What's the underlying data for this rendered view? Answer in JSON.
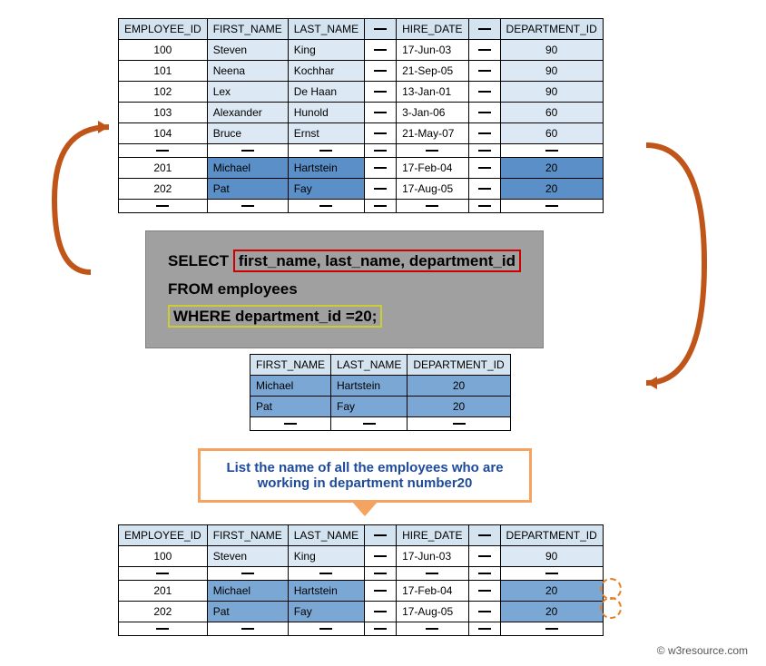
{
  "table1": {
    "headers": [
      "EMPLOYEE_ID",
      "FIRST_NAME",
      "LAST_NAME",
      "—",
      "HIRE_DATE",
      "—",
      "DEPARTMENT_ID"
    ],
    "rows": [
      {
        "emp_id": "100",
        "first": "Steven",
        "last": "King",
        "hire": "17-Jun-03",
        "dept": "90",
        "highlight": "light"
      },
      {
        "emp_id": "101",
        "first": "Neena",
        "last": "Kochhar",
        "hire": "21-Sep-05",
        "dept": "90",
        "highlight": "light"
      },
      {
        "emp_id": "102",
        "first": "Lex",
        "last": "De Haan",
        "hire": "13-Jan-01",
        "dept": "90",
        "highlight": "light"
      },
      {
        "emp_id": "103",
        "first": "Alexander",
        "last": "Hunold",
        "hire": "3-Jan-06",
        "dept": "60",
        "highlight": "light"
      },
      {
        "emp_id": "104",
        "first": "Bruce",
        "last": "Ernst",
        "hire": "21-May-07",
        "dept": "60",
        "highlight": "light"
      },
      {
        "emp_id": "",
        "first": "",
        "last": "",
        "hire": "",
        "dept": "",
        "highlight": "dashrow"
      },
      {
        "emp_id": "201",
        "first": "Michael",
        "last": "Hartstein",
        "hire": "17-Feb-04",
        "dept": "20",
        "highlight": "dark"
      },
      {
        "emp_id": "202",
        "first": "Pat",
        "last": "Fay",
        "hire": "17-Aug-05",
        "dept": "20",
        "highlight": "dark"
      },
      {
        "emp_id": "",
        "first": "",
        "last": "",
        "hire": "",
        "dept": "",
        "highlight": "dashrow"
      }
    ]
  },
  "sql": {
    "select_kw": "SELECT",
    "columns": "first_name, last_name, department_id",
    "from_kw": "FROM",
    "table": "employees",
    "where_kw": "WHERE",
    "where_cond": "department_id =20;"
  },
  "table2": {
    "headers": [
      "FIRST_NAME",
      "LAST_NAME",
      "DEPARTMENT_ID"
    ],
    "rows": [
      {
        "first": "Michael",
        "last": "Hartstein",
        "dept": "20"
      },
      {
        "first": "Pat",
        "last": "Fay",
        "dept": "20"
      }
    ]
  },
  "callout": "List the name of all the employees who are working in department number20",
  "table3": {
    "headers": [
      "EMPLOYEE_ID",
      "FIRST_NAME",
      "LAST_NAME",
      "—",
      "HIRE_DATE",
      "—",
      "DEPARTMENT_ID"
    ],
    "rows": [
      {
        "emp_id": "100",
        "first": "Steven",
        "last": "King",
        "hire": "17-Jun-03",
        "dept": "90",
        "highlight": "light"
      },
      {
        "emp_id": "",
        "first": "",
        "last": "",
        "hire": "",
        "dept": "",
        "highlight": "dashrow"
      },
      {
        "emp_id": "201",
        "first": "Michael",
        "last": "Hartstein",
        "hire": "17-Feb-04",
        "dept": "20",
        "highlight": "med"
      },
      {
        "emp_id": "202",
        "first": "Pat",
        "last": "Fay",
        "hire": "17-Aug-05",
        "dept": "20",
        "highlight": "med"
      },
      {
        "emp_id": "",
        "first": "",
        "last": "",
        "hire": "",
        "dept": "",
        "highlight": "dashrow"
      }
    ]
  },
  "copyright": "© w3resource.com"
}
